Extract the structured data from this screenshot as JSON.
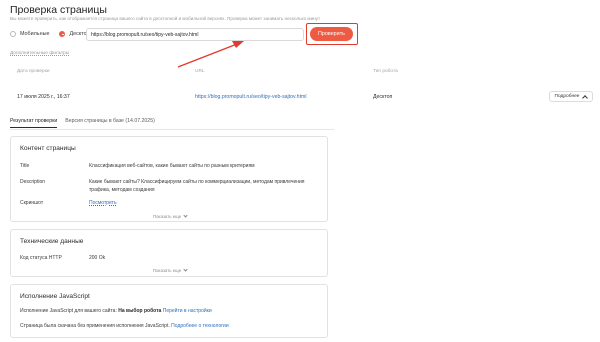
{
  "page": {
    "title": "Проверка страницы",
    "subtitle": "Вы можете проверить, как отображается страница вашего сайта в десктопной и мобильной версиях. Проверка может занимать несколько минут"
  },
  "form": {
    "radio_mobile": "Мобильные",
    "radio_desktop": "Десктоп",
    "selected": "Десктоп",
    "url_value": "https://blog.promopult.ru/seo/tipy-veb-sajtov.html",
    "check_button": "Проверить",
    "extra_filters": "Дополнительные фильтры"
  },
  "results_table": {
    "headers": [
      "Дата проверки",
      "URL",
      "Тип робота"
    ],
    "row": {
      "date": "17 июля 2025 г., 16:37",
      "url": "https://blog.promopult.ru/seo/tipy-veb-sajtov.html",
      "robot": "Десктоп",
      "details_button": "Подробнее"
    }
  },
  "tabs": [
    {
      "label": "Результат проверки",
      "active": true
    },
    {
      "label": "Версия страницы в базе (14.07.2025)",
      "active": false
    }
  ],
  "content_panel": {
    "title": "Контент страницы",
    "rows": [
      {
        "label": "Title",
        "value": "Классификация веб-сайтов, какие бывают сайты по разным критериям"
      },
      {
        "label": "Description",
        "value": "Какие бывают сайты? Классифицируем сайты по коммерциализации, методам привлечения трафика, методам создания"
      },
      {
        "label": "Скриншот",
        "value": "Посмотреть"
      }
    ],
    "show_more": "Показать еще"
  },
  "tech_panel": {
    "title": "Технические данные",
    "rows": [
      {
        "label": "Код статуса HTTP",
        "value": "200 Ok"
      }
    ],
    "show_more": "Показать еще"
  },
  "js_panel": {
    "title": "Исполнение JavaScript",
    "line1_prefix": "Исполнение JavaScript для вашего сайта:",
    "line1_bold": "На выбор робота",
    "line1_link": "Перейти в настройки",
    "line2_prefix": "Страница была скачана без применения исполнения JavaScript.",
    "line2_link": "Подробнее о технологии"
  },
  "colors": {
    "accent": "#ee5a42",
    "highlight_box": "#e23a2f",
    "link": "#2f6fbd"
  }
}
